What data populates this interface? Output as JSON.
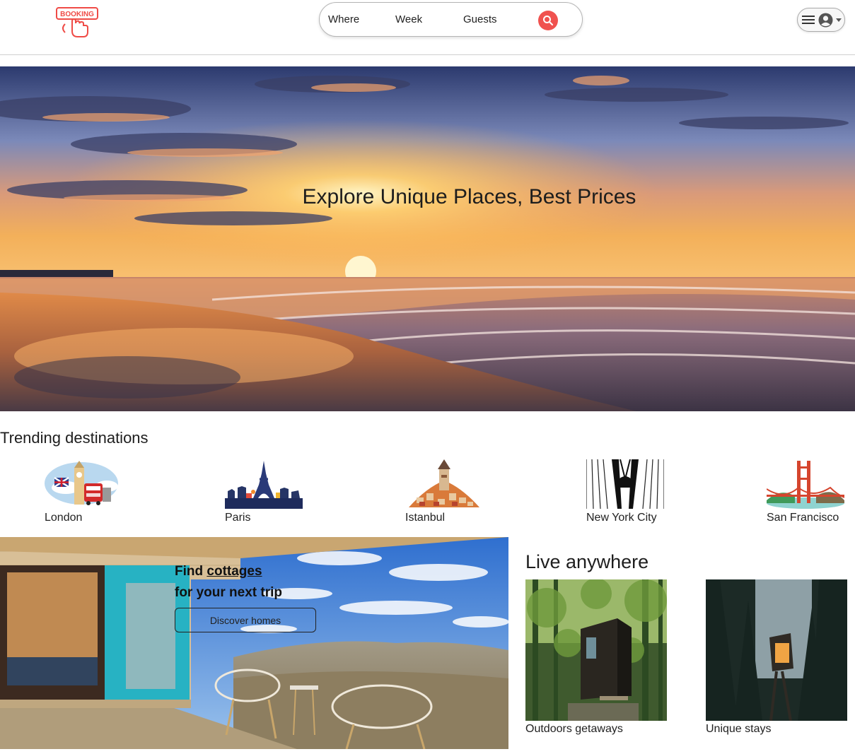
{
  "header": {
    "logo_text": "BOOKING",
    "search": {
      "where_label": "Where",
      "week_label": "Week",
      "guests_label": "Guests",
      "search_icon": "search-icon"
    },
    "user_menu": {
      "menu_icon": "hamburger-icon",
      "avatar_icon": "user-avatar-icon"
    }
  },
  "hero": {
    "title": "Explore Unique Places, Best Prices"
  },
  "trending": {
    "title": "Trending destinations",
    "destinations": [
      {
        "name": "London"
      },
      {
        "name": "Paris"
      },
      {
        "name": "Istanbul"
      },
      {
        "name": "New York City"
      },
      {
        "name": "San Francisco"
      }
    ]
  },
  "promo": {
    "line1_prefix": "Find ",
    "line1_link": "cottages",
    "line2": "for your next trip",
    "button_label": "Discover homes"
  },
  "live_anywhere": {
    "title": "Live anywhere",
    "cards": [
      {
        "label": "Outdoors getaways"
      },
      {
        "label": "Unique stays"
      }
    ]
  },
  "colors": {
    "brand": "#f0524f",
    "text": "#222222",
    "border": "#cfcfcf"
  }
}
